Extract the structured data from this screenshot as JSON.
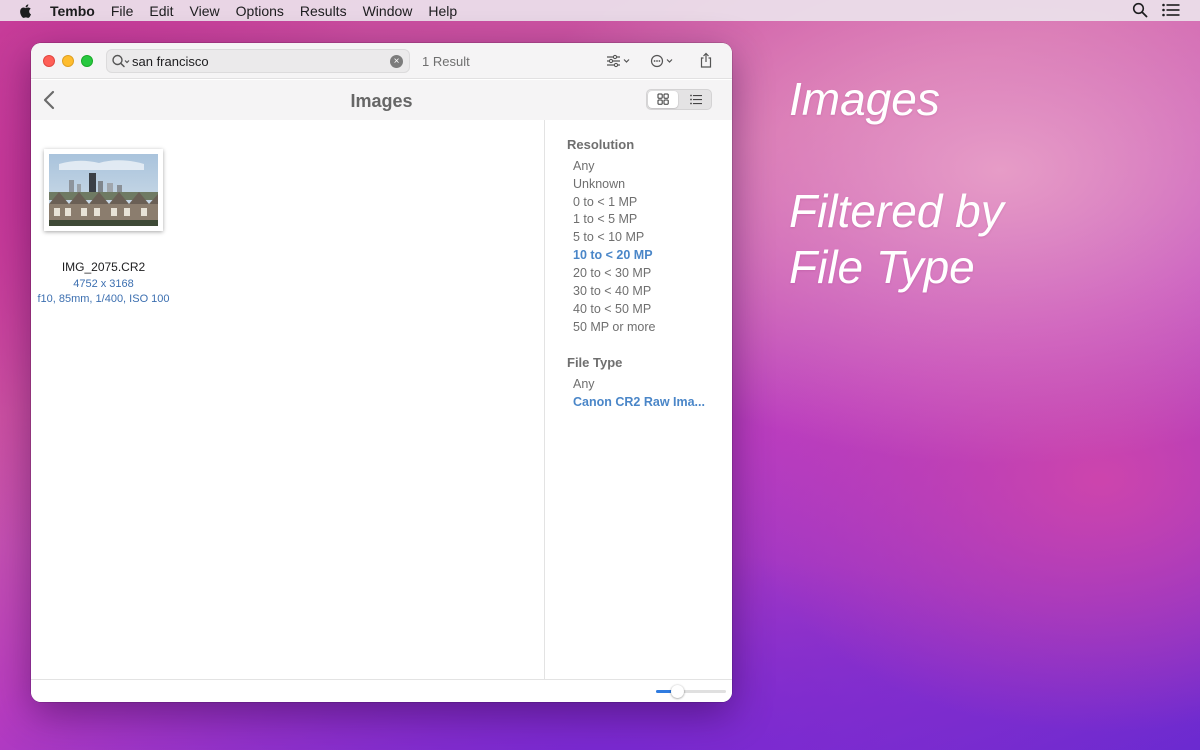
{
  "menubar": {
    "app_name": "Tembo",
    "items": [
      "File",
      "Edit",
      "View",
      "Options",
      "Results",
      "Window",
      "Help"
    ]
  },
  "toolbar": {
    "search_query": "san francisco",
    "result_count": "1 Result"
  },
  "navbar": {
    "title": "Images"
  },
  "results": [
    {
      "file_name": "IMG_2075.CR2",
      "dimensions": "4752 x 3168",
      "exif": "f10, 85mm, 1/400, ISO 100"
    }
  ],
  "filters": {
    "resolution": {
      "heading": "Resolution",
      "options": [
        "Any",
        "Unknown",
        "0 to < 1 MP",
        "1 to < 5 MP",
        "5 to < 10 MP",
        "10 to < 20 MP",
        "20 to < 30 MP",
        "30 to < 40 MP",
        "40 to < 50 MP",
        "50 MP or more"
      ],
      "selected": "10 to < 20 MP"
    },
    "file_type": {
      "heading": "File Type",
      "options": [
        "Any",
        "Canon CR2 Raw Ima..."
      ],
      "selected": "Canon CR2 Raw Ima..."
    }
  },
  "zoom_slider": {
    "value": 0.3
  },
  "caption": {
    "line1": "Images",
    "line2": "Filtered by",
    "line3": "File Type"
  },
  "colors": {
    "accent": "#4a86c8",
    "slider_fill": "#2f7be0"
  }
}
